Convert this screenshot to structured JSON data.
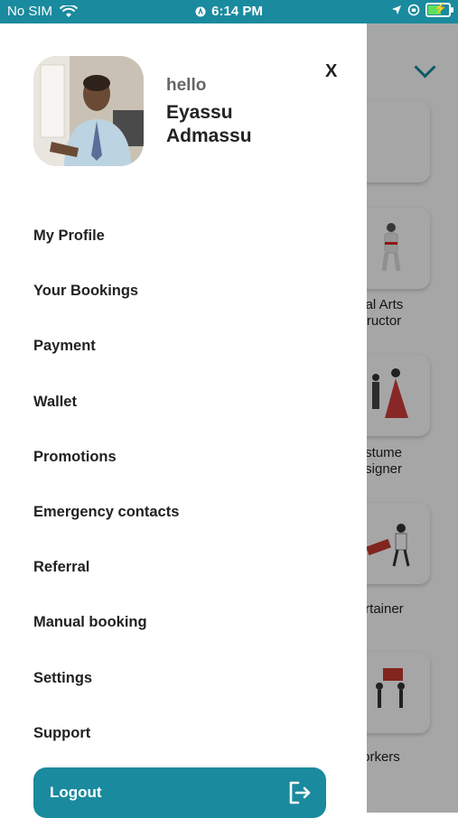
{
  "status_bar": {
    "carrier": "No SIM",
    "time": "6:14 PM"
  },
  "drawer": {
    "greeting": "hello",
    "user_name": "Eyassu Admassu",
    "close_label": "X",
    "menu": [
      {
        "label": "My Profile"
      },
      {
        "label": "Your Bookings"
      },
      {
        "label": "Payment"
      },
      {
        "label": "Wallet"
      },
      {
        "label": "Promotions"
      },
      {
        "label": "Emergency contacts"
      },
      {
        "label": "Referral"
      },
      {
        "label": "Manual booking"
      },
      {
        "label": "Settings"
      },
      {
        "label": "Support"
      }
    ],
    "logout_label": "Logout"
  },
  "background": {
    "categories": [
      {
        "label": "artial Arts\nnstructor"
      },
      {
        "label": "Costume\nDesigner"
      },
      {
        "label": "ntertainer"
      },
      {
        "label": "Workers"
      }
    ]
  },
  "colors": {
    "accent": "#1a8a9e",
    "text": "#222222",
    "muted": "#666666"
  }
}
